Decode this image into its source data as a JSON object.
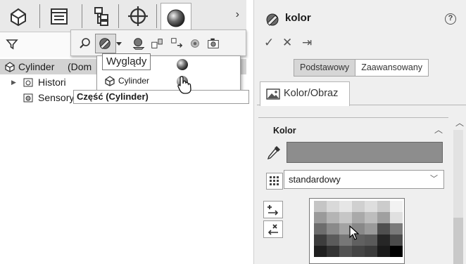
{
  "left": {
    "tabs": [
      "feature-manager-icon",
      "property-manager-icon",
      "configuration-manager-icon",
      "dimxpert-icon",
      "display-manager-icon"
    ],
    "more_label": "›",
    "tooltip": "Wygląd",
    "tooltip_visible": "Wyglądy",
    "popup_icons": [
      "search-icon",
      "appearance-icon",
      "dropdown-arrow-icon",
      "scene-icon",
      "decal-icon",
      "transfer-icon",
      "hide-show-icon",
      "camera-icon"
    ],
    "tree": {
      "root": "Cylinder",
      "root_suffix": "(Dom",
      "items": [
        "Histori",
        "Sensory"
      ]
    },
    "dropdown_item": "Cylinder",
    "part_label": "Część (Cylinder)"
  },
  "right": {
    "title": "kolor",
    "help": "?",
    "actions": [
      "✓",
      "✕",
      "⇥"
    ],
    "segments": [
      "Podstawowy",
      "Zaawansowany"
    ],
    "tab_label": "Kolor/Obraz",
    "group_title": "Kolor",
    "color_value": "#8d8d8d",
    "select_value": "standardowy",
    "palette_rows": [
      [
        "#c5c5c5",
        "#d9d9d9",
        "#e6e6e6",
        "#d0d0d0",
        "#dedede",
        "#cccccc",
        "#f2f2f2"
      ],
      [
        "#9a9a9a",
        "#b4b4b4",
        "#c6c6c6",
        "#a9a9a9",
        "#bdbdbd",
        "#a0a0a0",
        "#e0e0e0"
      ],
      [
        "#6d6d6d",
        "#8a8a8a",
        "#a3a3a3",
        "#888888",
        "#9a9a9a",
        "#4f4f4f",
        "#7a7a7a"
      ],
      [
        "#3d3d3d",
        "#5b5b5b",
        "#777777",
        "#606060",
        "#5a5a5a",
        "#262626",
        "#4a4a4a"
      ],
      [
        "#1f1f1f",
        "#333333",
        "#525252",
        "#444444",
        "#3b3b3b",
        "#1a1a1a",
        "#000000"
      ]
    ]
  }
}
